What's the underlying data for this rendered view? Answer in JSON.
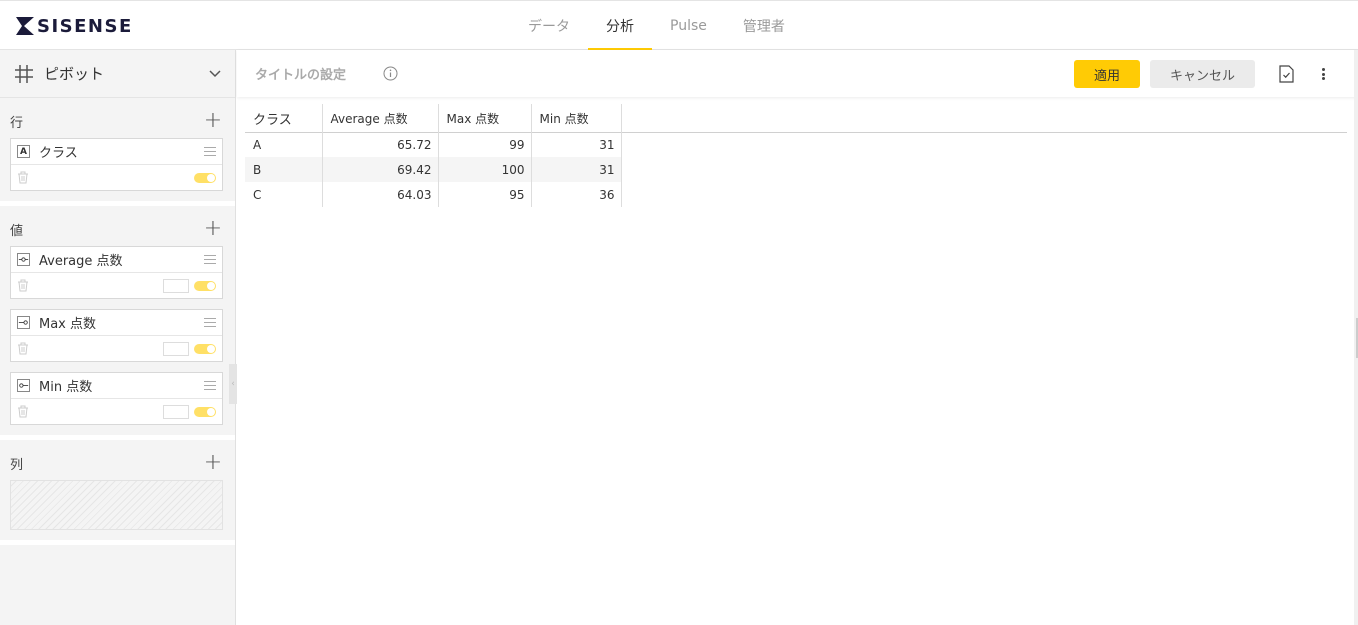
{
  "app": {
    "logo_text": "SISENSE"
  },
  "nav": {
    "tabs": [
      {
        "label": "データ",
        "active": false
      },
      {
        "label": "分析",
        "active": true
      },
      {
        "label": "Pulse",
        "active": false
      },
      {
        "label": "管理者",
        "active": false
      }
    ]
  },
  "sidebar": {
    "widget_type": "ピボット",
    "rows_title": "行",
    "rows": [
      {
        "label": "クラス",
        "type": "A"
      }
    ],
    "values_title": "値",
    "values": [
      {
        "label": "Average 点数"
      },
      {
        "label": "Max 点数"
      },
      {
        "label": "Min 点数"
      }
    ],
    "columns_title": "列"
  },
  "main": {
    "title_placeholder": "タイトルの設定",
    "apply_label": "適用",
    "cancel_label": "キャンセル"
  },
  "table": {
    "headers": [
      "クラス",
      "Average 点数",
      "Max 点数",
      "Min 点数"
    ],
    "rows": [
      [
        "A",
        "65.72",
        "99",
        "31"
      ],
      [
        "B",
        "69.42",
        "100",
        "31"
      ],
      [
        "C",
        "64.03",
        "95",
        "36"
      ]
    ]
  },
  "colors": {
    "accent": "#ffcb05",
    "toggle": "#ffe066"
  }
}
